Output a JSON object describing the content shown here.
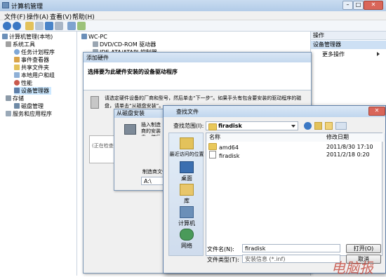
{
  "main_window": {
    "title": "计算机管理",
    "menu": [
      "文件(F)",
      "操作(A)",
      "查看(V)",
      "帮助(H)"
    ],
    "tree": {
      "root": "计算机管理(本地)",
      "system_tools": "系统工具",
      "task_scheduler": "任务计划程序",
      "event_viewer": "事件查看器",
      "shared_folders": "共享文件夹",
      "local_users": "本地用户和组",
      "performance": "性能",
      "device_manager": "设备管理器",
      "storage": "存储",
      "disk_management": "磁盘管理",
      "services_apps": "服务和应用程序"
    },
    "center": {
      "computer": "WC-PC",
      "dvd": "DVD/CD-ROM 驱动器",
      "ide": "IDE ATA/ATAPI 控制器"
    },
    "actions": {
      "header": "操作",
      "selected": "设备管理器",
      "more": "更多操作"
    }
  },
  "wizard": {
    "title": "添加硬件",
    "heading": "选择要为此硬件安装的设备驱动程序",
    "description": "请选定硬件设备的厂商和型号，然后单击“下一步”。如果手头有包含要安装的驱动程序的磁盘，请单击“从磁盘安装”。",
    "checking_text": "(正在检查"
  },
  "disk_dialog": {
    "title": "从磁盘安装",
    "instruction": "插入制造商的安装盘，然后确定已在下面选定正确的驱动器。",
    "copy_from_label": "制造商文件复制来源:",
    "copy_from_value": "A:\\"
  },
  "find_dialog": {
    "title": "查找文件",
    "look_in_label": "查找范围(I):",
    "look_in_value": "firadisk",
    "places": [
      "最近访问的位置",
      "桌面",
      "库",
      "计算机",
      "网络"
    ],
    "columns": {
      "name": "名称",
      "modified": "修改日期"
    },
    "files": [
      {
        "name": "amd64",
        "modified": "2011/8/30 17:10"
      },
      {
        "name": "firadisk",
        "modified": "2011/2/18 0:20"
      }
    ],
    "filename_label": "文件名(N):",
    "filename_value": "firadisk",
    "filetype_label": "文件类型(T):",
    "filetype_value": "安装信息 (*.inf)",
    "open_button": "打开(O)",
    "cancel_button": "取消"
  },
  "watermark": "电脑报",
  "colors": {
    "selection": "#cce8ff",
    "title_bar": "#c4d8ee",
    "watermark": "#c0392b"
  }
}
